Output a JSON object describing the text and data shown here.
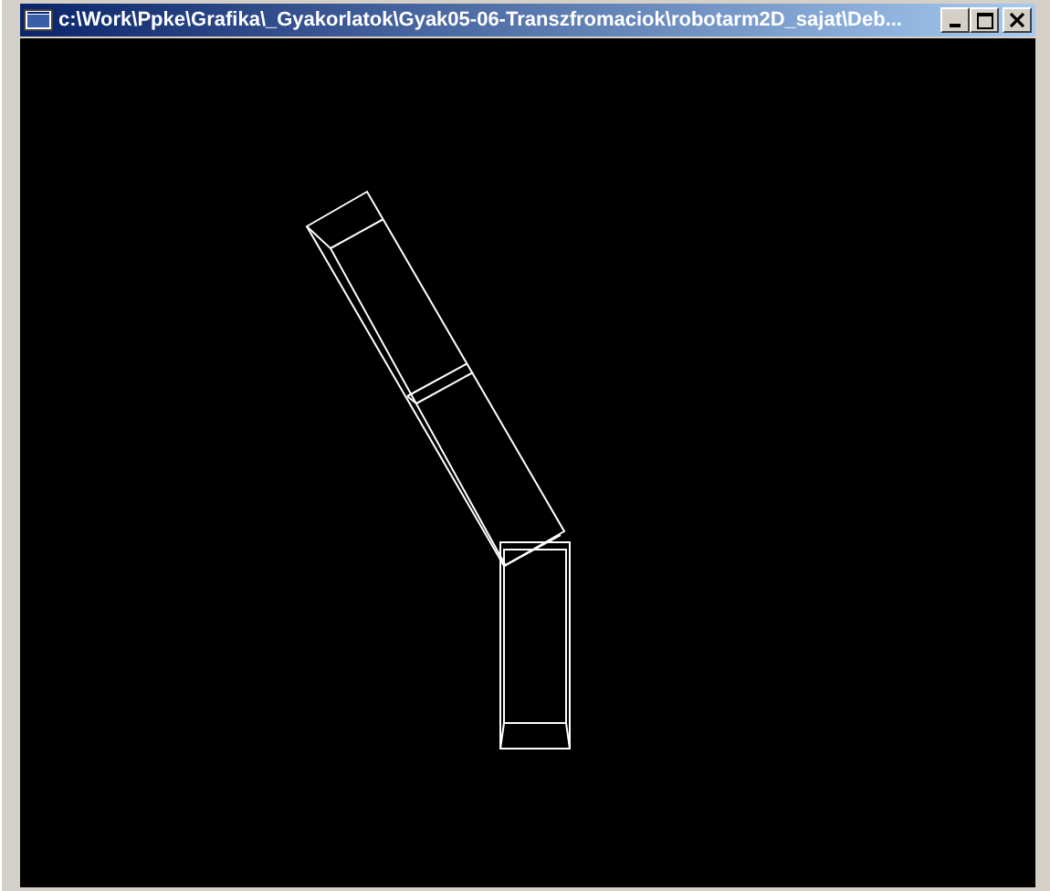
{
  "window": {
    "title": "c:\\Work\\Ppke\\Grafika\\_Gyakorlatok\\Gyak05-06-Transzfromaciok\\robotarm2D_sajat\\Deb..."
  }
}
